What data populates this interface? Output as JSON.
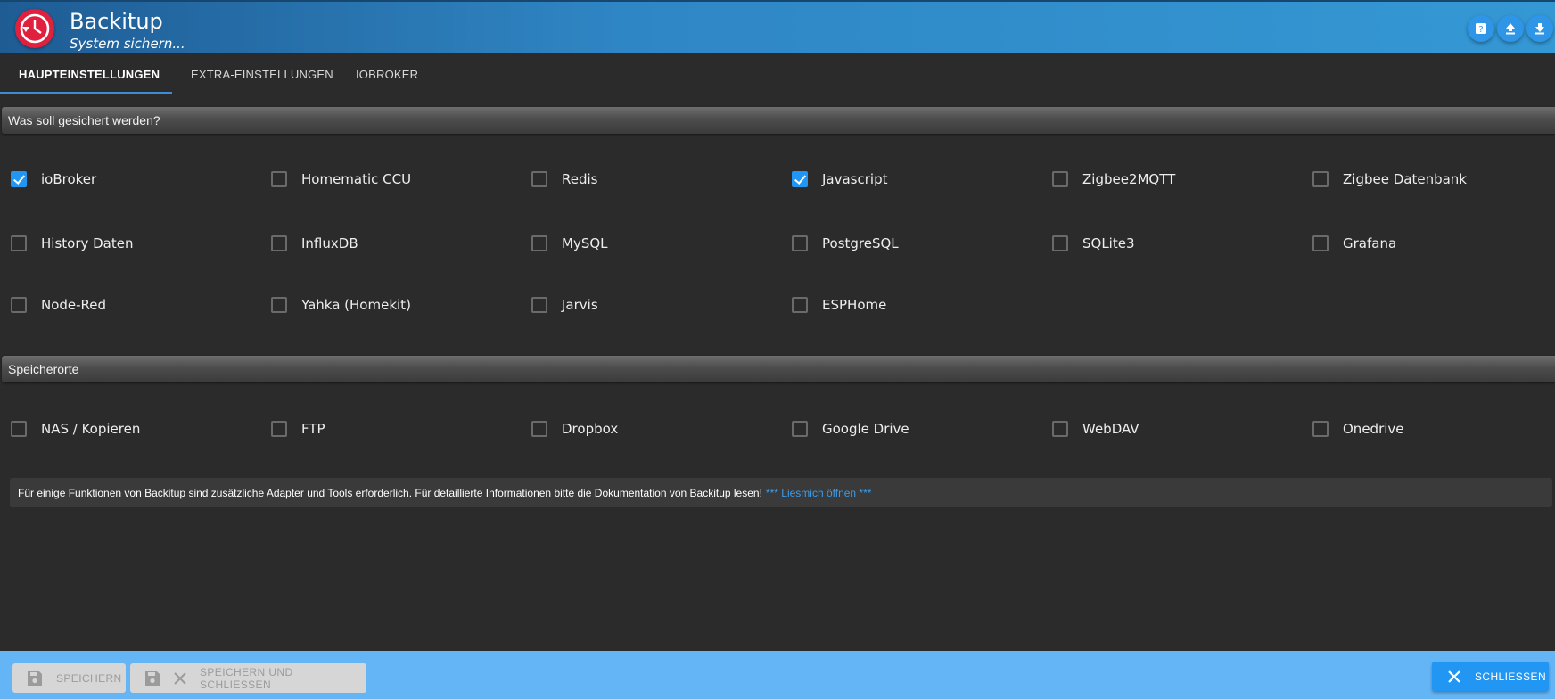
{
  "header": {
    "title": "Backitup",
    "subtitle": "System sichern..."
  },
  "tabs": [
    {
      "label": "HAUPTEINSTELLUNGEN",
      "active": true
    },
    {
      "label": "EXTRA-EINSTELLUNGEN",
      "active": false
    },
    {
      "label": "IOBROKER",
      "active": false
    }
  ],
  "sections": {
    "backup": {
      "title": "Was soll gesichert werden?",
      "items": [
        {
          "label": "ioBroker",
          "checked": true
        },
        {
          "label": "Homematic CCU",
          "checked": false
        },
        {
          "label": "Redis",
          "checked": false
        },
        {
          "label": "Javascript",
          "checked": true
        },
        {
          "label": "Zigbee2MQTT",
          "checked": false
        },
        {
          "label": "Zigbee Datenbank",
          "checked": false
        },
        {
          "label": "History Daten",
          "checked": false
        },
        {
          "label": "InfluxDB",
          "checked": false
        },
        {
          "label": "MySQL",
          "checked": false
        },
        {
          "label": "PostgreSQL",
          "checked": false
        },
        {
          "label": "SQLite3",
          "checked": false
        },
        {
          "label": "Grafana",
          "checked": false
        },
        {
          "label": "Node-Red",
          "checked": false
        },
        {
          "label": "Yahka (Homekit)",
          "checked": false
        },
        {
          "label": "Jarvis",
          "checked": false
        },
        {
          "label": "ESPHome",
          "checked": false
        }
      ]
    },
    "storage": {
      "title": "Speicherorte",
      "items": [
        {
          "label": "NAS / Kopieren",
          "checked": false
        },
        {
          "label": "FTP",
          "checked": false
        },
        {
          "label": "Dropbox",
          "checked": false
        },
        {
          "label": "Google Drive",
          "checked": false
        },
        {
          "label": "WebDAV",
          "checked": false
        },
        {
          "label": "Onedrive",
          "checked": false
        }
      ]
    }
  },
  "info": {
    "text": "Für einige Funktionen von Backitup sind zusätzliche Adapter und Tools erforderlich. Für detaillierte Informationen bitte die Dokumentation von Backitup lesen!",
    "link": "*** Liesmich öffnen ***"
  },
  "footer": {
    "save": "SPEICHERN",
    "save_close": "SPEICHERN UND SCHLIESSEN",
    "close": "SCHLIESSEN"
  },
  "colors": {
    "accent": "#2196f3",
    "header": "#3498d4",
    "footer": "#64b5f6",
    "logo": "#e0203c",
    "background": "#2b2b2b"
  }
}
